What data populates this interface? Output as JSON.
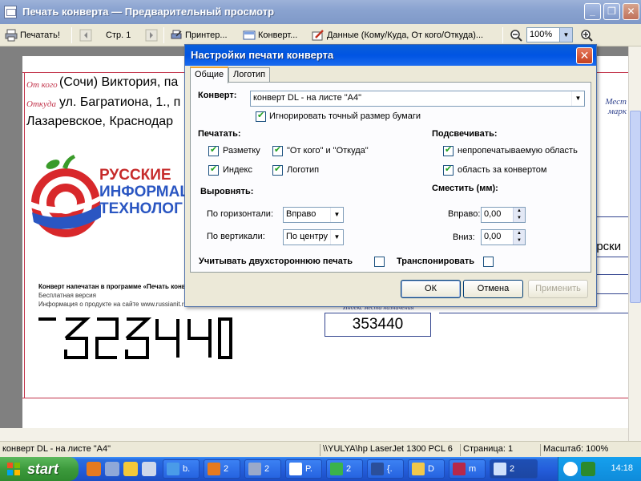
{
  "window": {
    "title": "Печать конверта — Предварительный просмотр",
    "min_label": "_",
    "max_label": "❐",
    "close_label": "✕"
  },
  "toolbar": {
    "print_label": "Печатать!",
    "page_label": "Стр. 1",
    "printer_label": "Принтер...",
    "envelope_label": "Конверт...",
    "data_label": "Данные (Кому/Куда, От кого/Откуда)...",
    "zoom_value": "100%",
    "zoom_out_icon": "magnifier-minus",
    "zoom_in_icon": "magnifier-plus"
  },
  "envelope": {
    "from_label": "От кого",
    "from_value": "(Сочи) Виктория, па",
    "where_label": "Откуда",
    "where_value": "ул. Багратиона, 1., п",
    "line3": "Лазаревское, Краснодар",
    "stamp_label_1": "Мест",
    "stamp_label_2": "марк",
    "logo_line1": "РУССКИЕ",
    "logo_line2": "ИНФОРМАЦ",
    "logo_line3": "ТЕХНОЛОГ",
    "note_line1": "Конверт напечатан в программе «Печать конверт",
    "note_line2": "Бесплатная версия",
    "note_line3": "Информация о продукте на сайте www.russianit.r",
    "index_label": "Индекс места назначения",
    "index_value": "353440",
    "to_text": "арски"
  },
  "dialog": {
    "title": "Настройки печати конверта",
    "close_label": "✕",
    "tabs": [
      "Общие",
      "Логотип"
    ],
    "envelope_label": "Конверт:",
    "envelope_value": "конверт DL - на листе \"A4\"",
    "ignore_size_label": "Игнорировать точный размер бумаги",
    "ignore_size_checked": true,
    "print_heading": "Печатать:",
    "print_options": [
      {
        "label": "Разметку",
        "checked": true
      },
      {
        "label": "\"От кого\" и \"Откуда\"",
        "checked": true
      },
      {
        "label": "Индекс",
        "checked": true
      },
      {
        "label": "Логотип",
        "checked": true
      }
    ],
    "highlight_heading": "Подсвечивать:",
    "highlight_options": [
      {
        "label": "непропечатываемую область",
        "checked": true
      },
      {
        "label": "область за конвертом",
        "checked": true
      }
    ],
    "align_heading": "Выровнять:",
    "align_horizontal_label": "По горизонтали:",
    "align_horizontal_value": "Вправо",
    "align_vertical_label": "По вертикали:",
    "align_vertical_value": "По центру",
    "shift_heading": "Сместить (мм):",
    "shift_right_label": "Вправо:",
    "shift_right_value": "0,00",
    "shift_down_label": "Вниз:",
    "shift_down_value": "0,00",
    "duplex_label": "Учитывать двухстороннюю печать",
    "duplex_checked": false,
    "transpose_label": "Транспонировать",
    "transpose_checked": false,
    "ok_label": "ОК",
    "cancel_label": "Отмена",
    "apply_label": "Применить"
  },
  "statusbar": {
    "envelope": "конверт DL - на листе \"A4\"",
    "printer": "\\\\YULYA\\hp LaserJet 1300 PCL 6",
    "page": "Страница: 1",
    "scale": "Масштаб: 100%"
  },
  "taskbar": {
    "start_label": "start",
    "tasks": [
      "b.",
      "2",
      "2",
      "P.",
      "2",
      "{.",
      "D",
      "m",
      "2"
    ],
    "clock": "14:18"
  }
}
